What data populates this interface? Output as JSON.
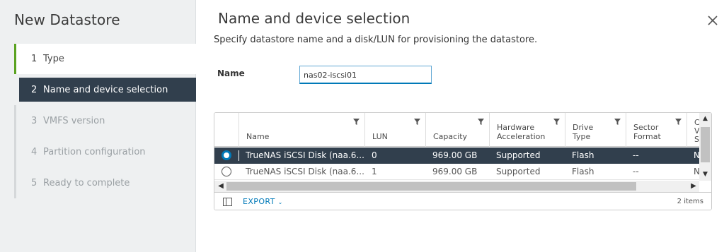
{
  "wizard": {
    "title": "New Datastore",
    "steps": [
      {
        "num": "1",
        "label": "Type",
        "state": "done"
      },
      {
        "num": "2",
        "label": "Name and device selection",
        "state": "active"
      },
      {
        "num": "3",
        "label": "VMFS version",
        "state": "todo"
      },
      {
        "num": "4",
        "label": "Partition configuration",
        "state": "todo"
      },
      {
        "num": "5",
        "label": "Ready to complete",
        "state": "todo"
      }
    ]
  },
  "page": {
    "title": "Name and device selection",
    "description": "Specify datastore name and a disk/LUN for provisioning the datastore.",
    "close_icon": "close-icon"
  },
  "form": {
    "name_label": "Name",
    "name_value": "nas02-iscsi01"
  },
  "grid": {
    "columns": [
      {
        "line1": "Name",
        "line2": ""
      },
      {
        "line1": "LUN",
        "line2": ""
      },
      {
        "line1": "Capacity",
        "line2": ""
      },
      {
        "line1": "Hardware",
        "line2": "Acceleration"
      },
      {
        "line1": "Drive",
        "line2": "Type"
      },
      {
        "line1": "Sector",
        "line2": "Format"
      },
      {
        "line1": "C",
        "line2": "V",
        "line3": "S"
      }
    ],
    "rows": [
      {
        "selected": true,
        "name": "TrueNAS iSCSI Disk (naa.6...",
        "lun": "0",
        "capacity": "969.00 GB",
        "hw_accel": "Supported",
        "drive_type": "Flash",
        "sector_format": "--",
        "extra": "N"
      },
      {
        "selected": false,
        "name": "TrueNAS iSCSI Disk (naa.6...",
        "lun": "1",
        "capacity": "969.00 GB",
        "hw_accel": "Supported",
        "drive_type": "Flash",
        "sector_format": "--",
        "extra": "N"
      }
    ],
    "footer": {
      "export_label": "EXPORT",
      "items_count": "2 items"
    }
  },
  "colors": {
    "accent": "#0079b8",
    "selected_row": "#313f4d",
    "done_step": "#5aa220"
  }
}
